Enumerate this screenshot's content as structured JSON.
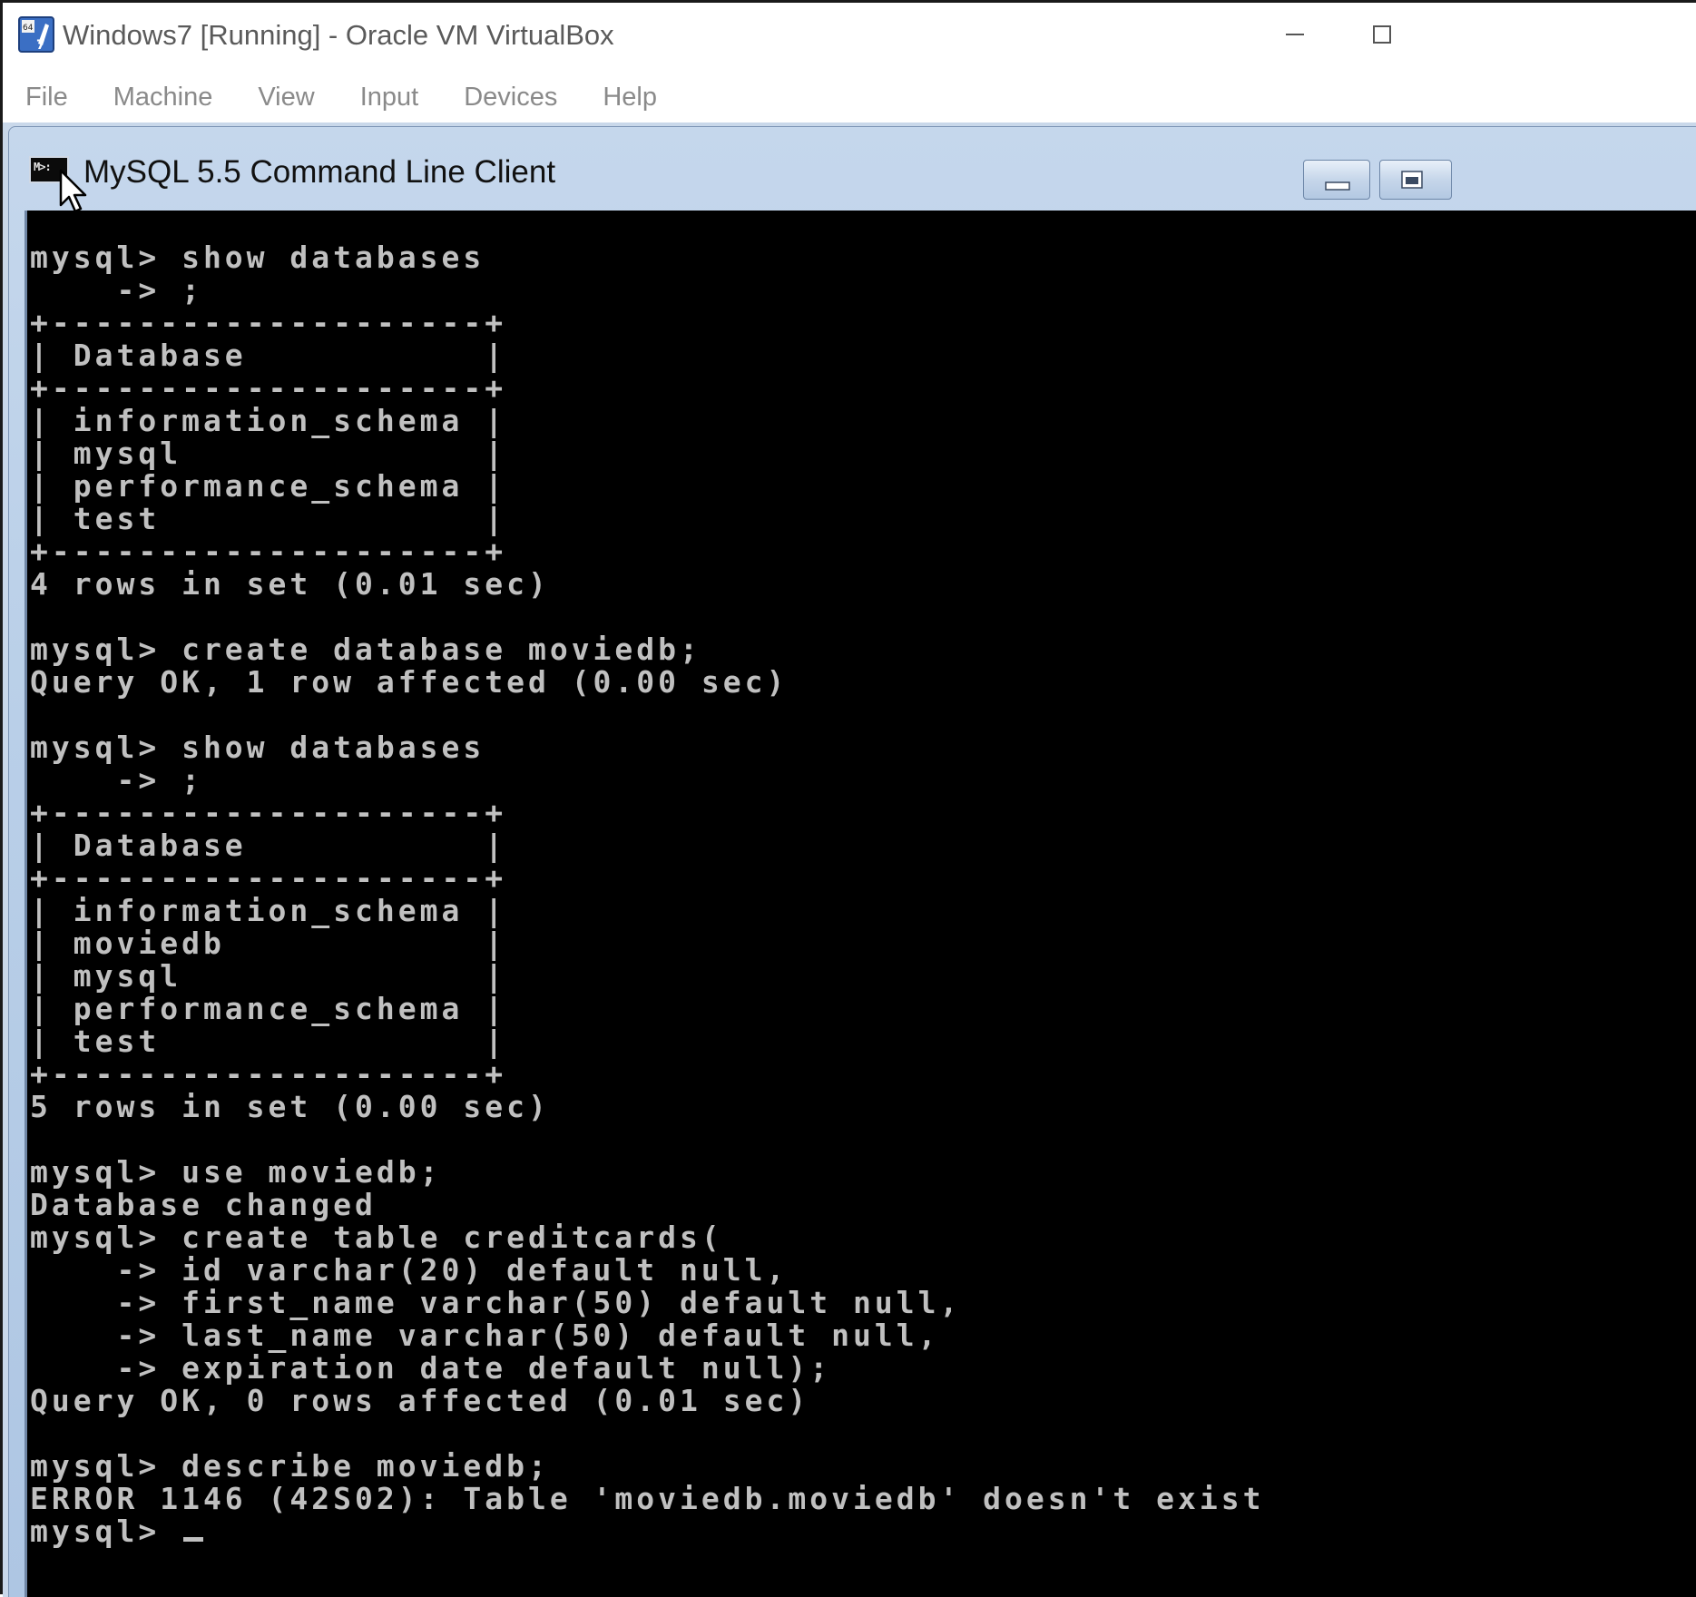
{
  "host": {
    "title": "Windows7 [Running] - Oracle VM VirtualBox",
    "icon": "virtualbox-windows7-icon",
    "menu": [
      "File",
      "Machine",
      "View",
      "Input",
      "Devices",
      "Help"
    ]
  },
  "guest": {
    "title": "MySQL 5.5 Command Line Client",
    "icon_label": "M>:"
  },
  "console": {
    "lines": [
      "mysql> show databases",
      "    -> ;",
      "+--------------------+",
      "| Database           |",
      "+--------------------+",
      "| information_schema |",
      "| mysql              |",
      "| performance_schema |",
      "| test               |",
      "+--------------------+",
      "4 rows in set (0.01 sec)",
      "",
      "mysql> create database moviedb;",
      "Query OK, 1 row affected (0.00 sec)",
      "",
      "mysql> show databases",
      "    -> ;",
      "+--------------------+",
      "| Database           |",
      "+--------------------+",
      "| information_schema |",
      "| moviedb            |",
      "| mysql              |",
      "| performance_schema |",
      "| test               |",
      "+--------------------+",
      "5 rows in set (0.00 sec)",
      "",
      "mysql> use moviedb;",
      "Database changed",
      "mysql> create table creditcards(",
      "    -> id varchar(20) default null,",
      "    -> first_name varchar(50) default null,",
      "    -> last_name varchar(50) default null,",
      "    -> expiration date default null);",
      "Query OK, 0 rows affected (0.01 sec)",
      "",
      "mysql> describe moviedb;",
      "ERROR 1146 (42S02): Table 'moviedb.moviedb' doesn't exist"
    ],
    "prompt": "mysql> "
  },
  "colors": {
    "console_bg": "#000000",
    "console_text": "#c0c0c0",
    "vbox_accent": "#1f4f9a",
    "aero_titlebar": "#b9cfe8"
  }
}
